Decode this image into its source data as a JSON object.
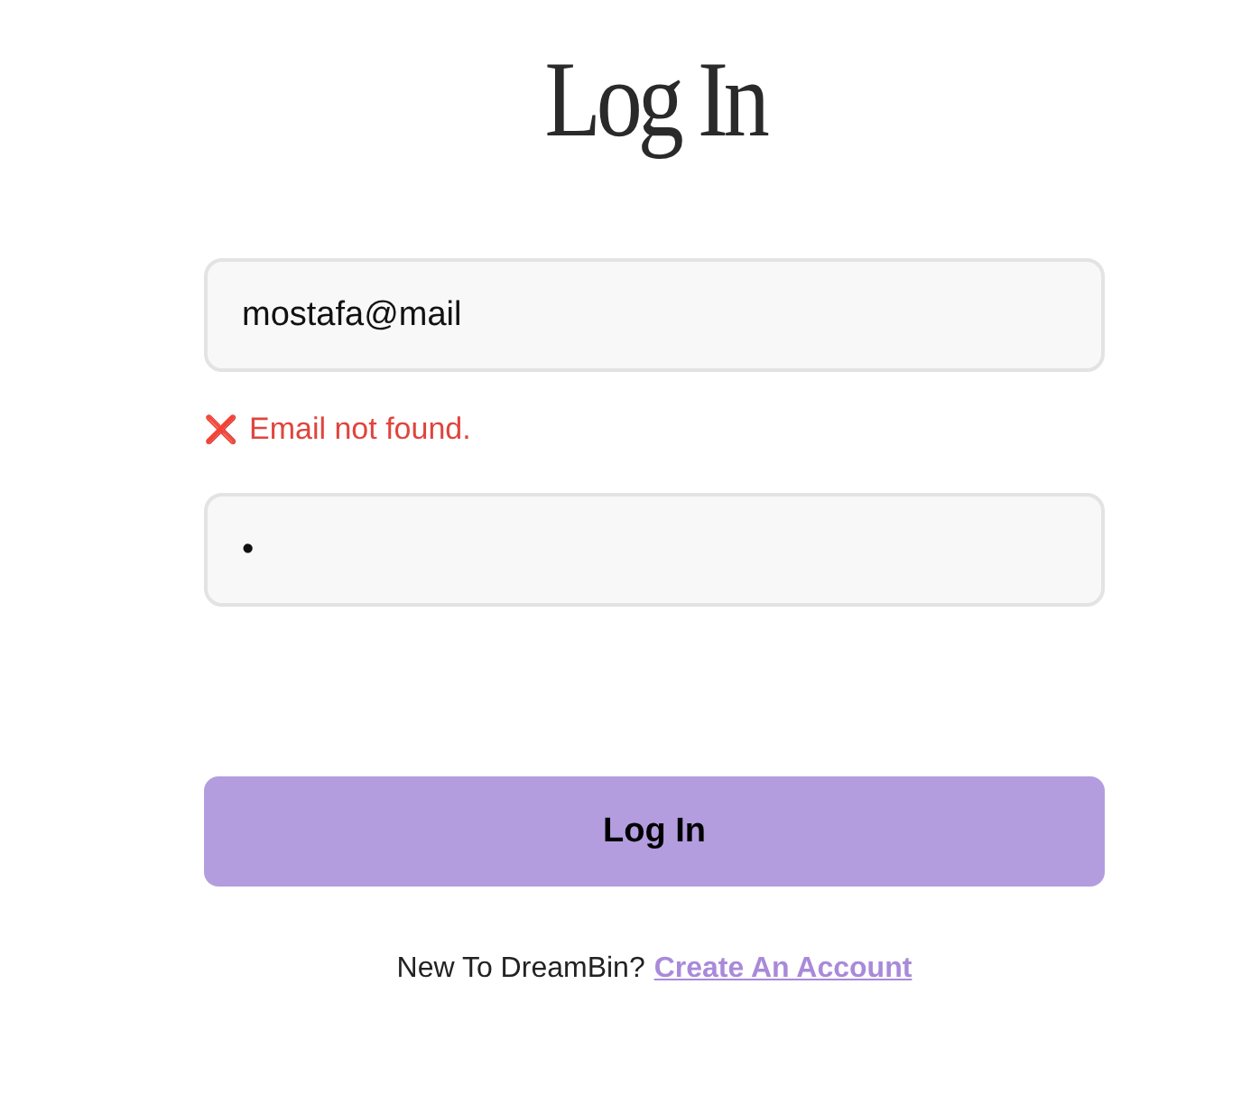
{
  "title": "Log In",
  "email_field": {
    "value": "mostafa@mail"
  },
  "email_error": {
    "icon": "❌",
    "message": "Email not found."
  },
  "password_field": {
    "value": "•"
  },
  "login_button": {
    "label": "Log In"
  },
  "footer": {
    "prompt": "New To DreamBin?",
    "link": "Create An Account"
  }
}
